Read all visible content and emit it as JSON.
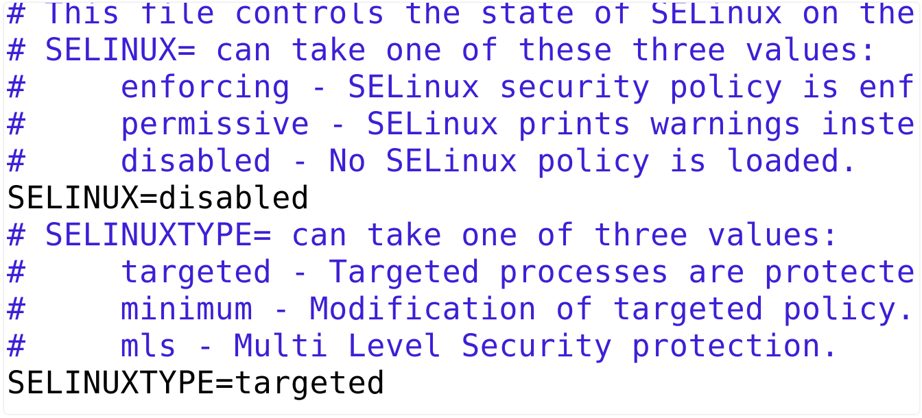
{
  "file": {
    "lines": [
      {
        "kind": "comment",
        "text": "# This file controls the state of SELinux on the"
      },
      {
        "kind": "comment",
        "text": "# SELINUX= can take one of these three values:"
      },
      {
        "kind": "comment",
        "text": "#     enforcing - SELinux security policy is enf"
      },
      {
        "kind": "comment",
        "text": "#     permissive - SELinux prints warnings inste"
      },
      {
        "kind": "comment",
        "text": "#     disabled - No SELinux policy is loaded."
      },
      {
        "kind": "code",
        "text": "SELINUX=disabled"
      },
      {
        "kind": "comment",
        "text": "# SELINUXTYPE= can take one of three values:"
      },
      {
        "kind": "comment",
        "text": "#     targeted - Targeted processes are protecte"
      },
      {
        "kind": "comment",
        "text": "#     minimum - Modification of targeted policy."
      },
      {
        "kind": "comment",
        "text": "#     mls - Multi Level Security protection."
      },
      {
        "kind": "code",
        "text": "SELINUXTYPE=targeted"
      }
    ]
  },
  "colors": {
    "comment": "#3d1fd6",
    "code": "#000000",
    "background": "#ffffff"
  }
}
